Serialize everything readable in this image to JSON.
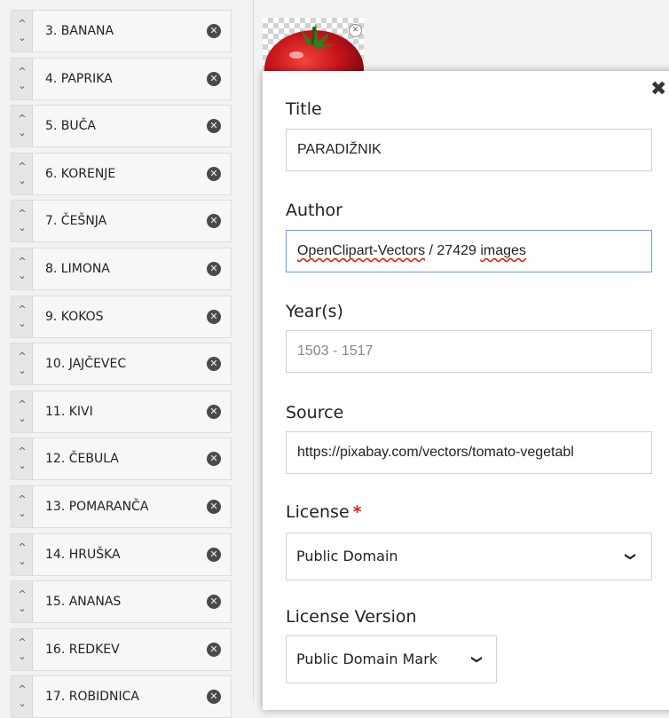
{
  "items": [
    {
      "label": "3. BANANA"
    },
    {
      "label": "4. PAPRIKA"
    },
    {
      "label": "5. BUČA"
    },
    {
      "label": "6. KORENJE"
    },
    {
      "label": "7. ČEŠNJA"
    },
    {
      "label": "8. LIMONA"
    },
    {
      "label": "9. KOKOS"
    },
    {
      "label": "10. JAJČEVEC"
    },
    {
      "label": "11. KIVI"
    },
    {
      "label": "12. ČEBULA"
    },
    {
      "label": "13. POMARANČA"
    },
    {
      "label": "14. HRUŠKA"
    },
    {
      "label": "15. ANANAS"
    },
    {
      "label": "16. REDKEV"
    },
    {
      "label": "17. ROBIDNICA"
    }
  ],
  "icons": {
    "move_up": "^",
    "move_down": "⌄",
    "remove": "✕",
    "close": "✖",
    "thumb_remove": "✕",
    "chevron": "❯"
  },
  "form": {
    "title_label": "Title",
    "title_value": "PARADIŽNIK",
    "author_label": "Author",
    "author_value": {
      "part1": "OpenClipart-Vectors",
      "sep": " / 27429 ",
      "part2": "images"
    },
    "year_label": "Year(s)",
    "year_placeholder": "1503 - 1517",
    "source_label": "Source",
    "source_value": "https://pixabay.com/vectors/tomato-vegetabl",
    "license_label": "License",
    "license_required_mark": "*",
    "license_value": "Public Domain",
    "license_version_label": "License Version",
    "license_version_value": "Public Domain Mark"
  },
  "colors": {
    "required": "#d9230f",
    "focus_border": "#6aa0d8",
    "tomato": "#c8121b"
  }
}
